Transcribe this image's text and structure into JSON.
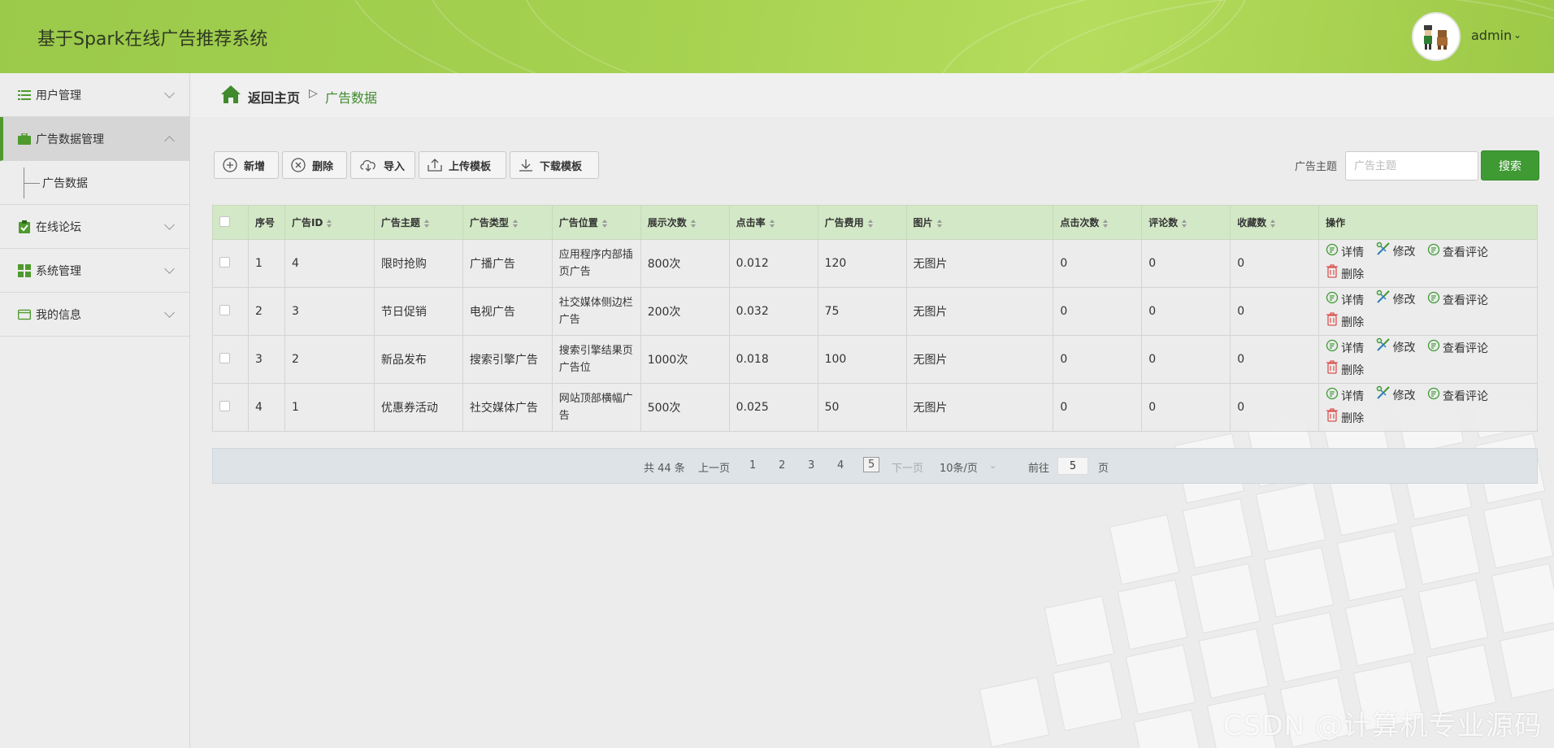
{
  "header": {
    "title": "基于Spark在线广告推荐系统",
    "user_name": "admin"
  },
  "sidebar": {
    "items": [
      {
        "label": "用户管理",
        "icon": "list-icon"
      },
      {
        "label": "广告数据管理",
        "icon": "briefcase-icon"
      },
      {
        "label": "广告数据"
      },
      {
        "label": "在线论坛",
        "icon": "clipboard-check-icon"
      },
      {
        "label": "系统管理",
        "icon": "grid-icon"
      },
      {
        "label": "我的信息",
        "icon": "id-card-icon"
      }
    ]
  },
  "breadcrumb": {
    "home": "返回主页",
    "separator": "▷",
    "current": "广告数据"
  },
  "toolbar": {
    "add": "新增",
    "delete": "删除",
    "import": "导入",
    "upload_template": "上传模板",
    "download_template": "下载模板"
  },
  "search": {
    "label": "广告主题",
    "placeholder": "广告主题",
    "button": "搜索"
  },
  "table": {
    "columns": [
      "序号",
      "广告ID",
      "广告主题",
      "广告类型",
      "广告位置",
      "展示次数",
      "点击率",
      "广告费用",
      "图片",
      "点击次数",
      "评论数",
      "收藏数",
      "操作"
    ],
    "rows": [
      {
        "index": "1",
        "ad_id": "4",
        "subject": "限时抢购",
        "type": "广播广告",
        "position": "应用程序内部插页广告",
        "views": "800次",
        "ctr": "0.012",
        "cost": "120",
        "image": "无图片",
        "clicks": "0",
        "comments": "0",
        "favorites": "0"
      },
      {
        "index": "2",
        "ad_id": "3",
        "subject": "节日促销",
        "type": "电视广告",
        "position": "社交媒体侧边栏广告",
        "views": "200次",
        "ctr": "0.032",
        "cost": "75",
        "image": "无图片",
        "clicks": "0",
        "comments": "0",
        "favorites": "0"
      },
      {
        "index": "3",
        "ad_id": "2",
        "subject": "新品发布",
        "type": "搜索引擎广告",
        "position": "搜索引擎结果页广告位",
        "views": "1000次",
        "ctr": "0.018",
        "cost": "100",
        "image": "无图片",
        "clicks": "0",
        "comments": "0",
        "favorites": "0"
      },
      {
        "index": "4",
        "ad_id": "1",
        "subject": "优惠券活动",
        "type": "社交媒体广告",
        "position": "网站顶部横幅广告",
        "views": "500次",
        "ctr": "0.025",
        "cost": "50",
        "image": "无图片",
        "clicks": "0",
        "comments": "0",
        "favorites": "0"
      }
    ],
    "actions": {
      "detail": "详情",
      "edit": "修改",
      "view_comments": "查看评论",
      "delete": "删除"
    }
  },
  "pagination": {
    "total": "共 44 条",
    "prev": "上一页",
    "pages": [
      "1",
      "2",
      "3",
      "4",
      "5"
    ],
    "current": "5",
    "next": "下一页",
    "page_size": "10条/页",
    "goto_label": "前往",
    "goto_value": "5",
    "goto_suffix": "页"
  },
  "watermark": "CSDN @计算机专业源码",
  "colors": {
    "accent": "#3f9a34",
    "header": "#a4d14f",
    "table_header": "#d3e8c6"
  }
}
